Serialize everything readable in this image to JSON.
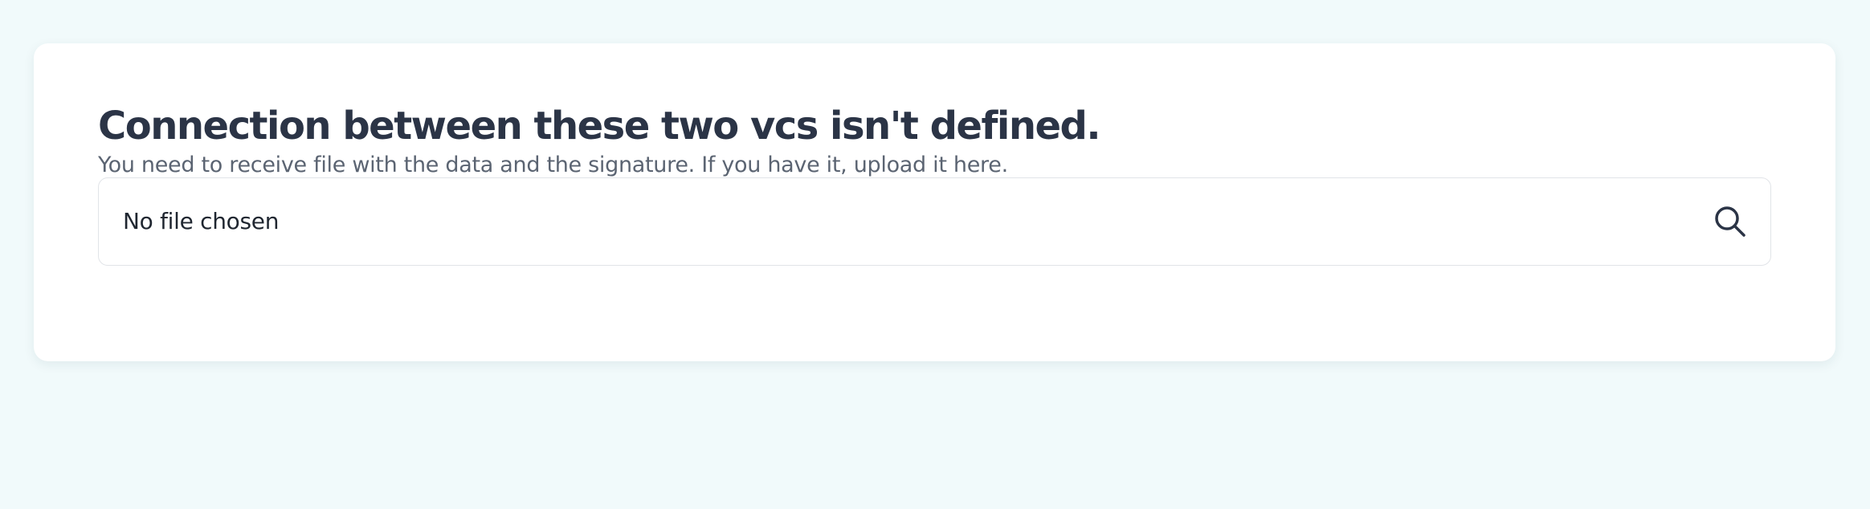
{
  "card": {
    "title": "Connection between these two vcs isn't defined.",
    "subtitle": "You need to receive file with the data and the signature. If you have it, upload it here."
  },
  "upload": {
    "status_text": "No file chosen",
    "icon": "search-icon"
  },
  "colors": {
    "page_background": "#f1fafb",
    "card_background": "#ffffff",
    "title_text": "#2b3446",
    "subtitle_text": "#5b6472",
    "field_border": "#e1e4e8"
  }
}
